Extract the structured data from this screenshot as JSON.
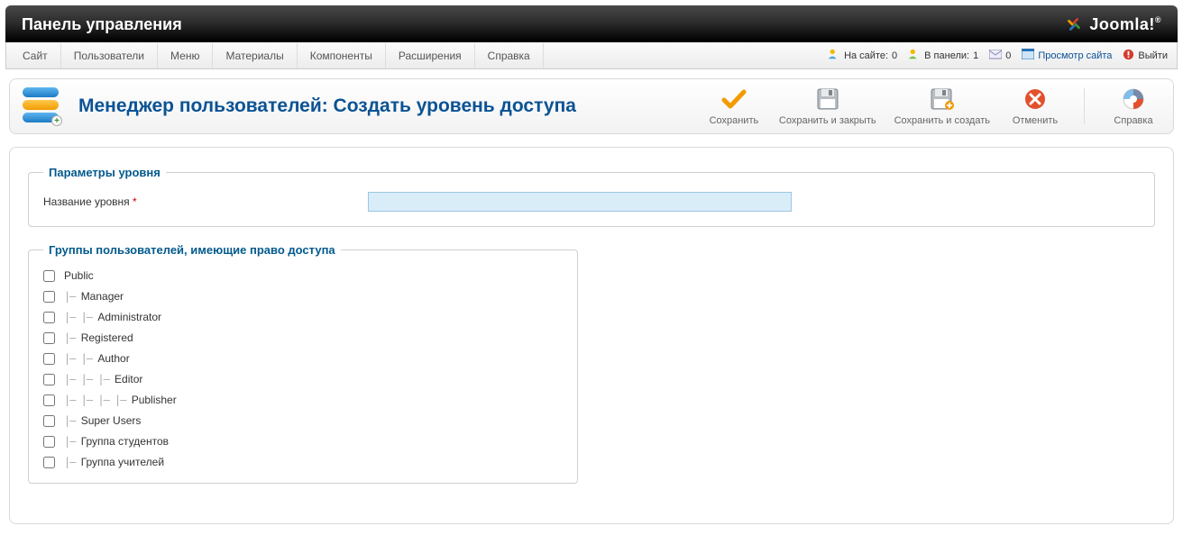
{
  "header": {
    "title": "Панель управления",
    "brand": "Joomla!"
  },
  "menu": {
    "items": [
      "Сайт",
      "Пользователи",
      "Меню",
      "Материалы",
      "Компоненты",
      "Расширения",
      "Справка"
    ]
  },
  "status": {
    "onsite_label": "На сайте:",
    "onsite_value": "0",
    "inpanel_label": "В панели:",
    "inpanel_value": "1",
    "messages_value": "0",
    "view_site": "Просмотр сайта",
    "logout": "Выйти"
  },
  "page": {
    "title": "Менеджер пользователей: Создать уровень доступа"
  },
  "toolbar": {
    "save": "Сохранить",
    "save_close": "Сохранить и закрыть",
    "save_new": "Сохранить и создать",
    "cancel": "Отменить",
    "help": "Справка"
  },
  "form": {
    "level_params_legend": "Параметры уровня",
    "level_name_label": "Название уровня",
    "level_name_value": "",
    "groups_legend": "Группы пользователей, имеющие право доступа",
    "groups": [
      {
        "name": "Public",
        "depth": 0
      },
      {
        "name": "Manager",
        "depth": 1
      },
      {
        "name": "Administrator",
        "depth": 2
      },
      {
        "name": "Registered",
        "depth": 1
      },
      {
        "name": "Author",
        "depth": 2
      },
      {
        "name": "Editor",
        "depth": 3
      },
      {
        "name": "Publisher",
        "depth": 4
      },
      {
        "name": "Super Users",
        "depth": 1
      },
      {
        "name": "Группа студентов",
        "depth": 1
      },
      {
        "name": "Группа учителей",
        "depth": 1
      }
    ]
  }
}
